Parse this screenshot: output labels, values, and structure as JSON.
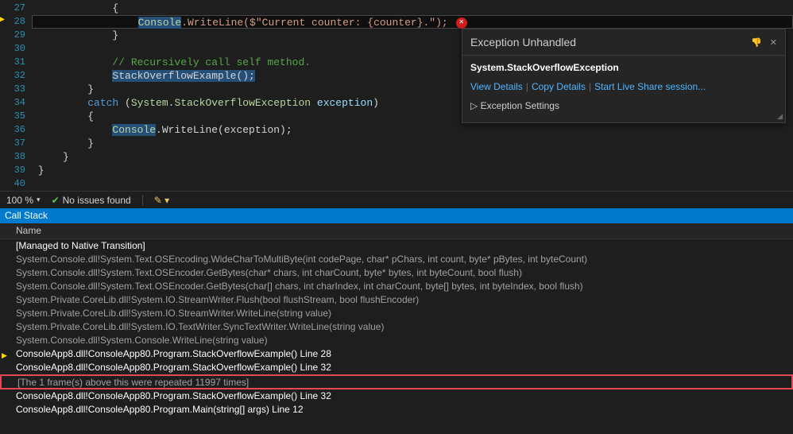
{
  "editor": {
    "lines": [
      27,
      28,
      29,
      30,
      31,
      32,
      33,
      34,
      35,
      36,
      37,
      38,
      39,
      40
    ],
    "code": {
      "l27": "             {",
      "l28_console": "Console",
      "l28_rest": ".WriteLine($\"Current counter: {counter}.\");",
      "l29": "             }",
      "l30": "",
      "l31_cmt": "             // Recursively call self method.",
      "l32_call": "             StackOverflowExample();",
      "l33": "         }",
      "l34_catch_kw": "         catch",
      "l34_rest": " (System.StackOverflowException exception)",
      "l35": "         {",
      "l36_console": "Console",
      "l36_rest": ".WriteLine(exception);",
      "l37": "         }",
      "l38": "     }",
      "l39": " }",
      "l40": ""
    }
  },
  "popup": {
    "title": "Exception Unhandled",
    "exception": "System.StackOverflowException",
    "link_view": "View Details",
    "link_copy": "Copy Details",
    "link_live": "Start Live Share session...",
    "settings": "Exception Settings"
  },
  "status": {
    "zoom": "100 %",
    "issues": "No issues found"
  },
  "callstack": {
    "title": "Call Stack",
    "col_name": "Name",
    "frames": [
      "[Managed to Native Transition]",
      "System.Console.dll!System.Text.OSEncoding.WideCharToMultiByte(int codePage, char* pChars, int count, byte* pBytes, int byteCount)",
      "System.Console.dll!System.Text.OSEncoder.GetBytes(char* chars, int charCount, byte* bytes, int byteCount, bool flush)",
      "System.Console.dll!System.Text.OSEncoder.GetBytes(char[] chars, int charIndex, int charCount, byte[] bytes, int byteIndex, bool flush)",
      "System.Private.CoreLib.dll!System.IO.StreamWriter.Flush(bool flushStream, bool flushEncoder)",
      "System.Private.CoreLib.dll!System.IO.StreamWriter.WriteLine(string value)",
      "System.Private.CoreLib.dll!System.IO.TextWriter.SyncTextWriter.WriteLine(string value)",
      "System.Console.dll!System.Console.WriteLine(string value)",
      "ConsoleApp8.dll!ConsoleApp80.Program.StackOverflowExample() Line 28",
      "ConsoleApp8.dll!ConsoleApp80.Program.StackOverflowExample() Line 32",
      "[The 1 frame(s) above this were repeated 11997 times]",
      "ConsoleApp8.dll!ConsoleApp80.Program.StackOverflowExample() Line 32",
      "ConsoleApp8.dll!ConsoleApp80.Program.Main(string[] args) Line 12"
    ]
  }
}
